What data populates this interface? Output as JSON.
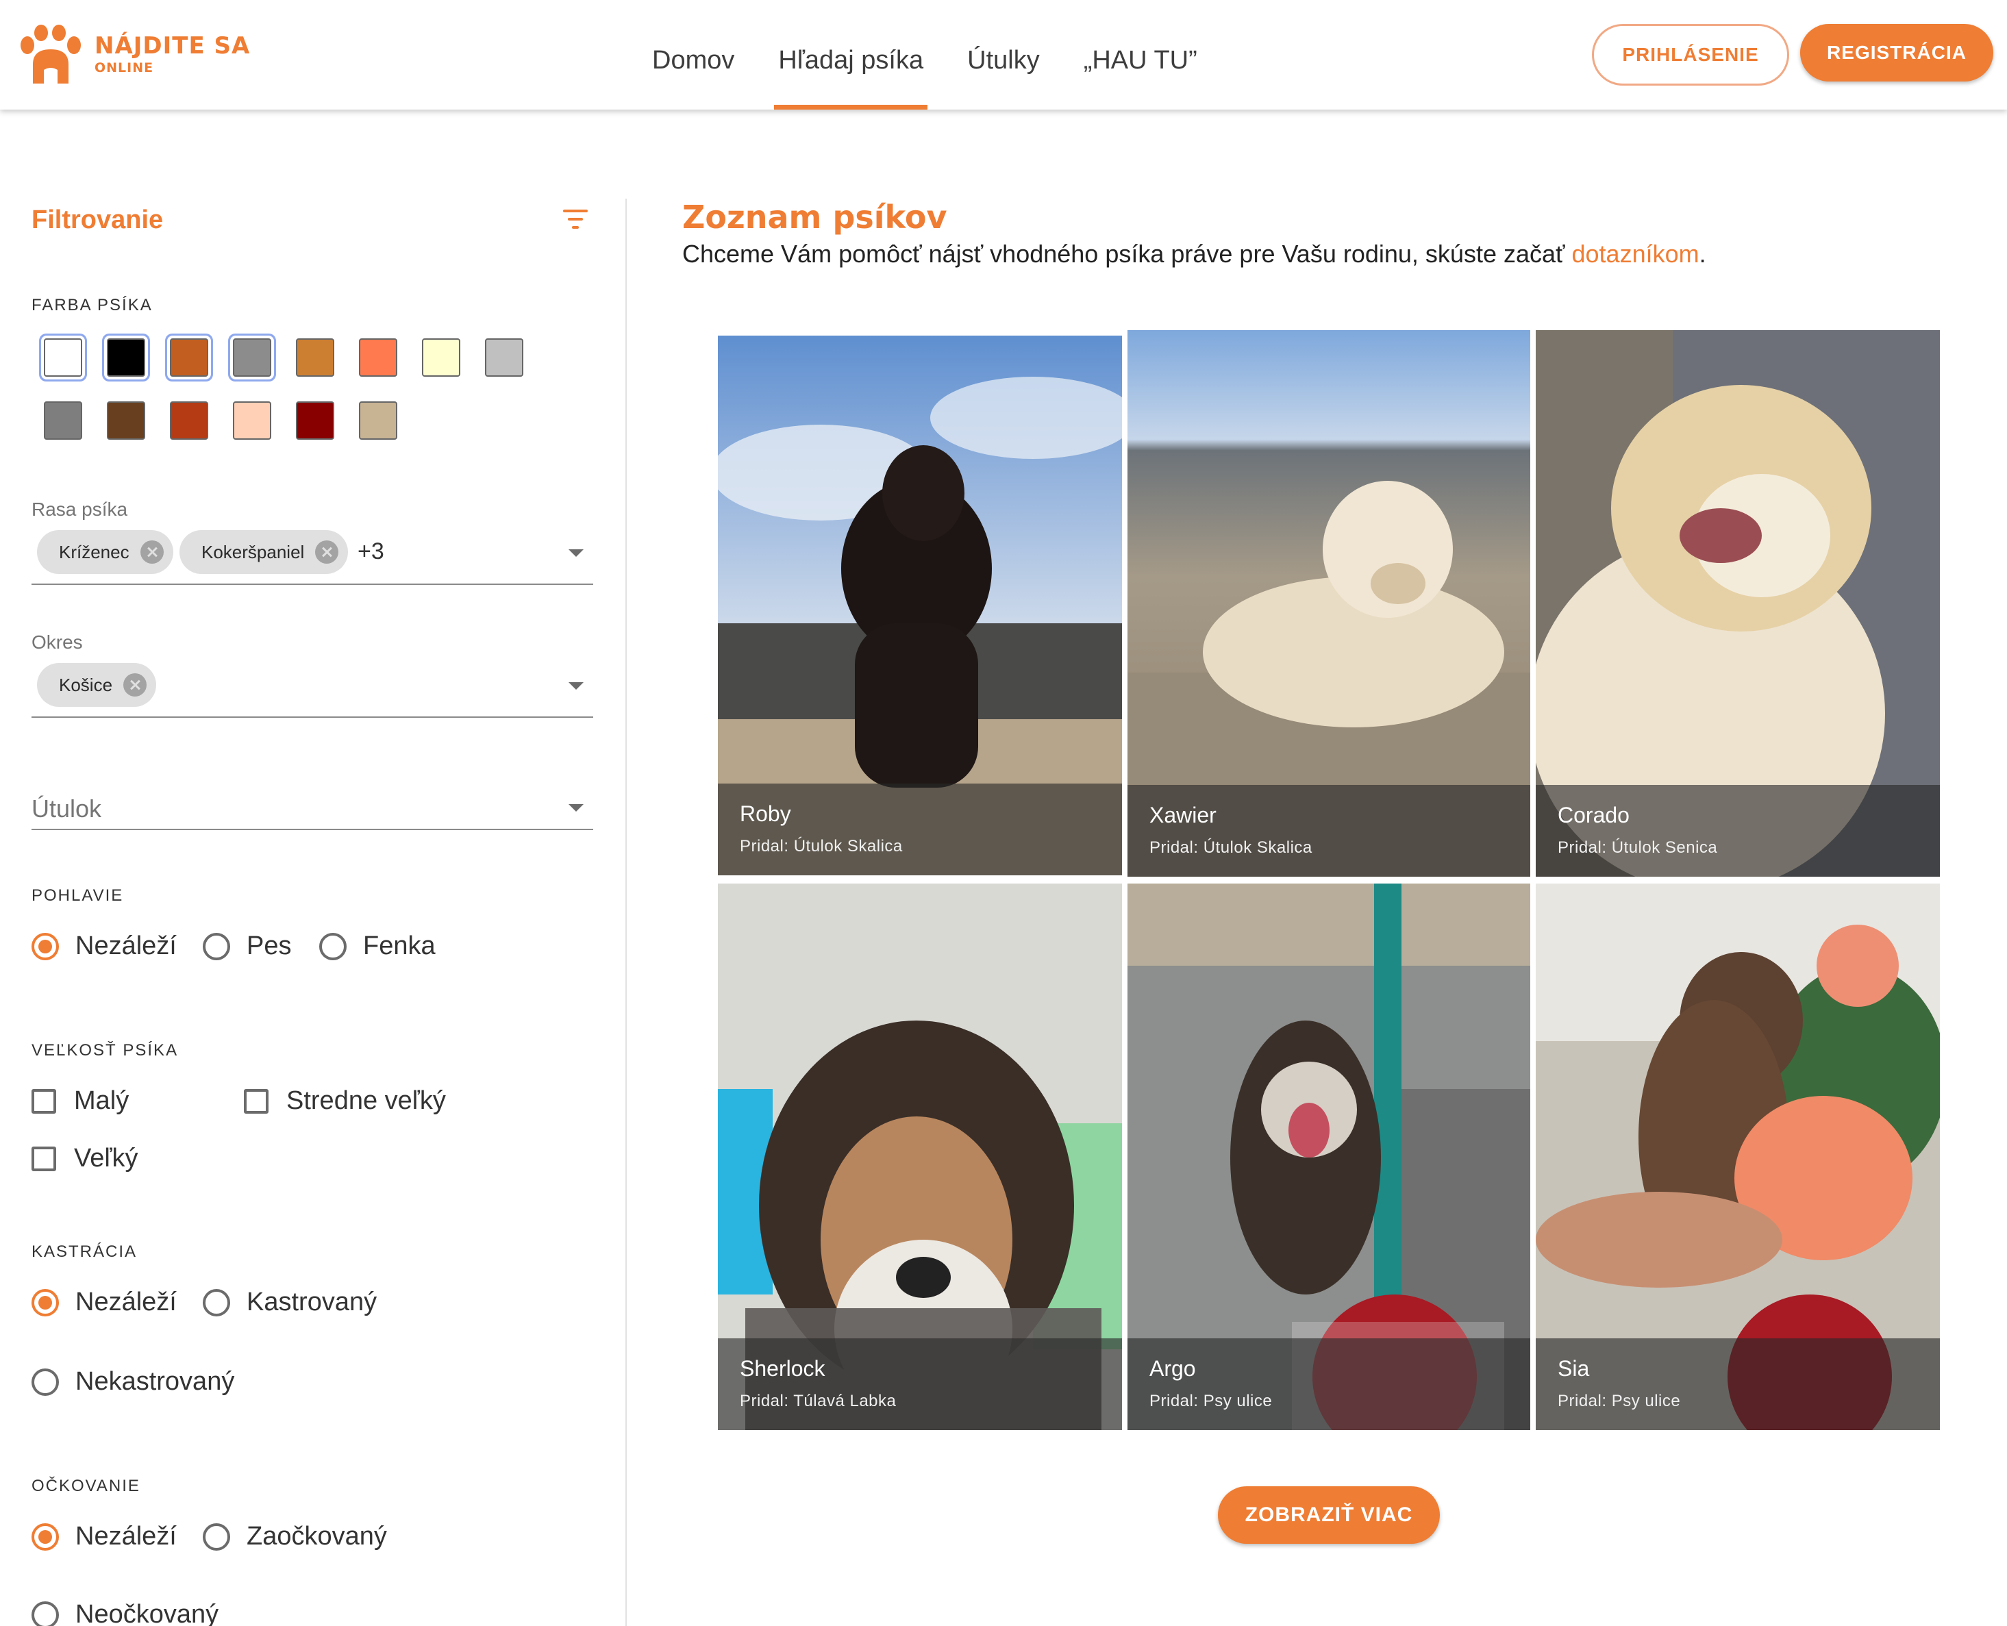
{
  "app": {
    "logo_line1": "NÁJDITE SA",
    "logo_line2": "ONLINE",
    "brand_color": "#ef7d33"
  },
  "nav": {
    "items": [
      "Domov",
      "Hľadaj psíka",
      "Útulky",
      "„HAU TU”"
    ],
    "active_index": 1
  },
  "auth": {
    "login_label": "PRIHLÁSENIE",
    "register_label": "REGISTRÁCIA"
  },
  "filters": {
    "title": "Filtrovanie",
    "color_section": {
      "label": "FARBA PSÍKA",
      "swatches": [
        {
          "color": "#ffffff",
          "selected": true
        },
        {
          "color": "#000000",
          "selected": true
        },
        {
          "color": "#c25e1f",
          "selected": true
        },
        {
          "color": "#8c8c8c",
          "selected": true
        },
        {
          "color": "#cc7f31",
          "selected": false
        },
        {
          "color": "#ff7a4f",
          "selected": false
        },
        {
          "color": "#ffffd0",
          "selected": false
        },
        {
          "color": "#c0c0c0",
          "selected": false
        },
        {
          "color": "#7e7e7e",
          "selected": false
        },
        {
          "color": "#69401f",
          "selected": false
        },
        {
          "color": "#b43b14",
          "selected": false
        },
        {
          "color": "#ffd0b5",
          "selected": false
        },
        {
          "color": "#880000",
          "selected": false
        },
        {
          "color": "#c8b393",
          "selected": false
        }
      ]
    },
    "breed": {
      "label": "Rasa psíka",
      "chips": [
        "Kríženec",
        "Kokeršpaniel"
      ],
      "more": "+3"
    },
    "district": {
      "label": "Okres",
      "chips": [
        "Košice"
      ]
    },
    "shelter": {
      "placeholder": "Útulok"
    },
    "gender": {
      "label": "POHLAVIE",
      "options": [
        "Nezáleží",
        "Pes",
        "Fenka"
      ],
      "selected": "Nezáleží"
    },
    "size": {
      "label": "VEĽKOSŤ PSÍKA",
      "options": [
        "Malý",
        "Stredne veľký",
        "Veľký"
      ]
    },
    "castration": {
      "label": "KASTRÁCIA",
      "options": [
        "Nezáleží",
        "Kastrovaný",
        "Nekastrovaný"
      ],
      "selected": "Nezáleží"
    },
    "vaccination": {
      "label": "OČKOVANIE",
      "options": [
        "Nezáleží",
        "Zaočkovaný",
        "Neočkovaný"
      ],
      "selected": "Nezáleží"
    }
  },
  "main": {
    "title": "Zoznam psíkov",
    "subtitle_pre": "Chceme Vám pomôcť nájsť vhodného psíka práve pre Vašu rodinu, skúste začať ",
    "subtitle_link": "dotazníkom",
    "subtitle_post": ".",
    "dogs": [
      {
        "name": "Roby",
        "author": "Pridal: Útulok Skalica"
      },
      {
        "name": "Xawier",
        "author": "Pridal: Útulok Skalica"
      },
      {
        "name": "Corado",
        "author": "Pridal: Útulok Senica"
      },
      {
        "name": "Sherlock",
        "author": "Pridal: Túlavá Labka"
      },
      {
        "name": "Argo",
        "author": "Pridal: Psy ulice"
      },
      {
        "name": "Sia",
        "author": "Pridal: Psy ulice"
      }
    ],
    "show_more_label": "ZOBRAZIŤ VIAC"
  }
}
